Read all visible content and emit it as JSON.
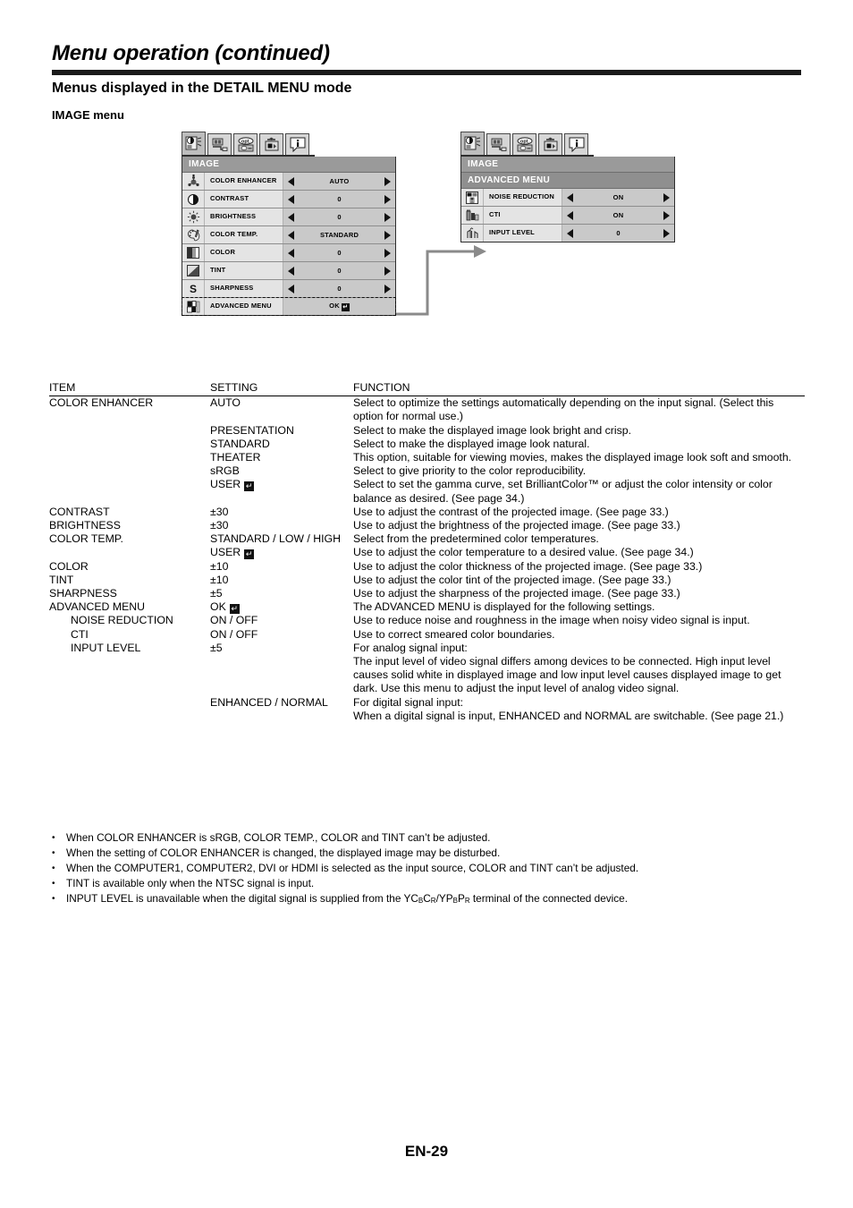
{
  "header": {
    "title": "Menu operation (continued)",
    "section": "Menus displayed in the DETAIL MENU mode",
    "subsection": "IMAGE menu"
  },
  "osd_left": {
    "tabs": [
      {
        "name": "image-tab",
        "glyph": "image"
      },
      {
        "name": "installation-tab",
        "glyph": "installation"
      },
      {
        "name": "option-tab",
        "glyph": "opt"
      },
      {
        "name": "feature-tab",
        "glyph": "feature"
      },
      {
        "name": "information-tab",
        "glyph": "info"
      }
    ],
    "header": "IMAGE",
    "rows": [
      {
        "icon": "color-enhancer-icon",
        "label": "COLOR ENHANCER",
        "value": "AUTO",
        "arrows": true
      },
      {
        "icon": "contrast-icon",
        "label": "CONTRAST",
        "value": "0",
        "arrows": true
      },
      {
        "icon": "brightness-icon",
        "label": "BRIGHTNESS",
        "value": "0",
        "arrows": true
      },
      {
        "icon": "color-temp-icon",
        "label": "COLOR TEMP.",
        "value": "STANDARD",
        "arrows": true
      },
      {
        "icon": "color-icon",
        "label": "COLOR",
        "value": "0",
        "arrows": true
      },
      {
        "icon": "tint-icon",
        "label": "TINT",
        "value": "0",
        "arrows": true
      },
      {
        "icon": "sharpness-icon",
        "label": "SHARPNESS",
        "value": "0",
        "arrows": true
      },
      {
        "icon": "advanced-menu-icon",
        "label": "ADVANCED MENU",
        "value": "OK",
        "arrows": false,
        "enter": true,
        "highlight": true
      }
    ]
  },
  "osd_right": {
    "tabs": [
      {
        "name": "image-tab",
        "glyph": "image"
      },
      {
        "name": "installation-tab",
        "glyph": "installation"
      },
      {
        "name": "option-tab",
        "glyph": "opt"
      },
      {
        "name": "feature-tab",
        "glyph": "feature"
      },
      {
        "name": "information-tab",
        "glyph": "info"
      }
    ],
    "header": "IMAGE",
    "subheader": "ADVANCED MENU",
    "rows": [
      {
        "icon": "noise-reduction-icon",
        "label": "NOISE REDUCTION",
        "value": "ON",
        "arrows": true
      },
      {
        "icon": "cti-icon",
        "label": "CTI",
        "value": "ON",
        "arrows": true
      },
      {
        "icon": "input-level-icon",
        "label": "INPUT LEVEL",
        "value": "0",
        "arrows": true
      }
    ]
  },
  "table": {
    "headers": {
      "item": "ITEM",
      "setting": "SETTING",
      "function": "FUNCTION"
    },
    "rows": [
      {
        "item": "COLOR ENHANCER",
        "setting": "AUTO",
        "function": "Select to optimize the settings automatically depending on the input signal. (Select this option for normal use.)",
        "indent": 0
      },
      {
        "item": "",
        "setting": "PRESENTATION",
        "function": "Select to make the displayed image look bright and crisp.",
        "indent": 0
      },
      {
        "item": "",
        "setting": "STANDARD",
        "function": "Select to make the displayed image look natural.",
        "indent": 0
      },
      {
        "item": "",
        "setting": "THEATER",
        "function": "This option, suitable for viewing movies, makes the displayed image look soft and smooth.",
        "indent": 0
      },
      {
        "item": "",
        "setting": "sRGB",
        "function": "Select to give priority to the color reproducibility.",
        "indent": 0
      },
      {
        "item": "",
        "setting": "USER",
        "setting_enter": true,
        "function": "Select to set the gamma curve, set BrilliantColor™ or adjust the color intensity or color balance as desired. (See page 34.)",
        "indent": 0
      },
      {
        "item": "CONTRAST",
        "setting": "±30",
        "function": "Use to adjust the contrast of the projected image. (See page 33.)",
        "indent": 0
      },
      {
        "item": "BRIGHTNESS",
        "setting": "±30",
        "function": "Use to adjust the brightness of the projected image. (See page 33.)",
        "indent": 0
      },
      {
        "item": "COLOR TEMP.",
        "setting": "STANDARD / LOW / HIGH",
        "function": "Select from the predetermined color temperatures.",
        "indent": 0
      },
      {
        "item": "",
        "setting": "USER",
        "setting_enter": true,
        "function": "Use to adjust the color temperature to a desired value. (See page 34.)",
        "indent": 0
      },
      {
        "item": "COLOR",
        "setting": "±10",
        "function": "Use to adjust the color thickness of the projected image. (See page 33.)",
        "indent": 0
      },
      {
        "item": "TINT",
        "setting": "±10",
        "function": "Use to adjust the color tint of the projected image. (See page 33.)",
        "indent": 0
      },
      {
        "item": "SHARPNESS",
        "setting": "±5",
        "function": "Use to adjust the sharpness of the projected image. (See page 33.)",
        "indent": 0
      },
      {
        "item": "ADVANCED MENU",
        "setting": "OK",
        "setting_enter": true,
        "function": "The ADVANCED MENU is displayed for the following settings.",
        "indent": 0
      },
      {
        "item": "NOISE REDUCTION",
        "setting": "ON / OFF",
        "function": "Use to reduce noise and roughness in the image when noisy video signal is input.",
        "indent": 1
      },
      {
        "item": "CTI",
        "setting": "ON / OFF",
        "function": "Use to correct smeared color boundaries.",
        "indent": 1
      },
      {
        "item": "INPUT LEVEL",
        "setting": "±5",
        "function": "For analog signal input:\nThe input level of video signal differs among devices to be connected. High input level causes solid white in displayed image and low input level causes displayed image to get dark. Use this menu to adjust the input level of analog video signal.",
        "indent": 1
      },
      {
        "item": "",
        "setting": "ENHANCED / NORMAL",
        "function": "For digital signal input:\nWhen a digital signal is input, ENHANCED and NORMAL are switchable. (See page 21.)",
        "indent": 1
      }
    ]
  },
  "notes": [
    "When COLOR ENHANCER is sRGB, COLOR TEMP., COLOR and TINT can’t be adjusted.",
    "When the setting of COLOR ENHANCER is changed, the displayed image may be disturbed.",
    "When the COMPUTER1, COMPUTER2, DVI or HDMI is selected as the input source, COLOR and TINT can’t be adjusted.",
    "TINT is available only when the NTSC signal is input.",
    "INPUT LEVEL is unavailable when the digital signal is supplied from the YC<sub>B</sub>C<sub>R</sub>/YP<sub>B</sub>P<sub>R</sub> terminal of the connected device."
  ],
  "footer": {
    "page": "EN-29"
  },
  "colors": {
    "rule": "#1a1a1a",
    "osd_header": "#9a9a9a",
    "osd_row": "#e4e4e4",
    "osd_value": "#c9c9c9",
    "connector": "#8a8a8a"
  }
}
